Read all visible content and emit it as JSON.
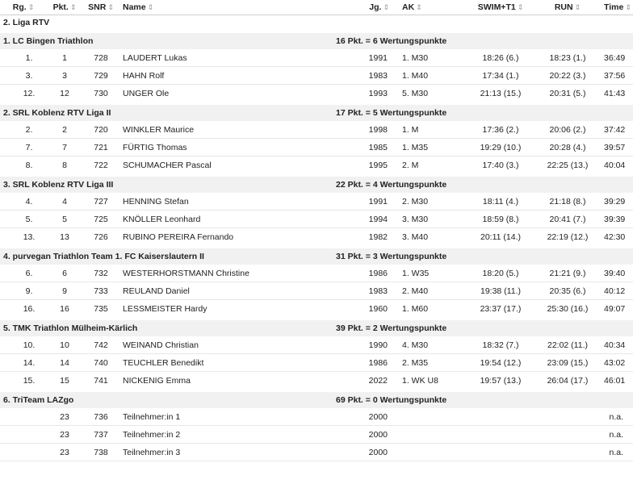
{
  "headers": {
    "rg": "Rg.",
    "pkt": "Pkt.",
    "snr": "SNR",
    "name": "Name",
    "jg": "Jg.",
    "ak": "AK",
    "swim": "SWIM+T1",
    "run": "RUN",
    "time": "Time",
    "sort_icon": "⇕"
  },
  "liga": "2. Liga RTV",
  "teams": [
    {
      "name": "1. LC Bingen Triathlon",
      "points": "16 Pkt. = 6 Wertungspunkte",
      "rows": [
        {
          "rg": "1.",
          "pkt": "1",
          "snr": "728",
          "name": "LAUDERT Lukas",
          "jg": "1991",
          "ak": "1. M30",
          "swim": "18:26 (6.)",
          "run": "18:23 (1.)",
          "time": "36:49"
        },
        {
          "rg": "3.",
          "pkt": "3",
          "snr": "729",
          "name": "HAHN Rolf",
          "jg": "1983",
          "ak": "1. M40",
          "swim": "17:34 (1.)",
          "run": "20:22 (3.)",
          "time": "37:56"
        },
        {
          "rg": "12.",
          "pkt": "12",
          "snr": "730",
          "name": "UNGER Ole",
          "jg": "1993",
          "ak": "5. M30",
          "swim": "21:13 (15.)",
          "run": "20:31 (5.)",
          "time": "41:43"
        }
      ]
    },
    {
      "name": "2. SRL Koblenz RTV Liga II",
      "points": "17 Pkt. = 5 Wertungspunkte",
      "rows": [
        {
          "rg": "2.",
          "pkt": "2",
          "snr": "720",
          "name": "WINKLER Maurice",
          "jg": "1998",
          "ak": "1. M",
          "swim": "17:36 (2.)",
          "run": "20:06 (2.)",
          "time": "37:42"
        },
        {
          "rg": "7.",
          "pkt": "7",
          "snr": "721",
          "name": "FÜRTIG Thomas",
          "jg": "1985",
          "ak": "1. M35",
          "swim": "19:29 (10.)",
          "run": "20:28 (4.)",
          "time": "39:57"
        },
        {
          "rg": "8.",
          "pkt": "8",
          "snr": "722",
          "name": "SCHUMACHER Pascal",
          "jg": "1995",
          "ak": "2. M",
          "swim": "17:40 (3.)",
          "run": "22:25 (13.)",
          "time": "40:04"
        }
      ]
    },
    {
      "name": "3. SRL Koblenz RTV Liga III",
      "points": "22 Pkt. = 4 Wertungspunkte",
      "rows": [
        {
          "rg": "4.",
          "pkt": "4",
          "snr": "727",
          "name": "HENNING Stefan",
          "jg": "1991",
          "ak": "2. M30",
          "swim": "18:11 (4.)",
          "run": "21:18 (8.)",
          "time": "39:29"
        },
        {
          "rg": "5.",
          "pkt": "5",
          "snr": "725",
          "name": "KNÖLLER Leonhard",
          "jg": "1994",
          "ak": "3. M30",
          "swim": "18:59 (8.)",
          "run": "20:41 (7.)",
          "time": "39:39"
        },
        {
          "rg": "13.",
          "pkt": "13",
          "snr": "726",
          "name": "RUBINO PEREIRA Fernando",
          "jg": "1982",
          "ak": "3. M40",
          "swim": "20:11 (14.)",
          "run": "22:19 (12.)",
          "time": "42:30"
        }
      ]
    },
    {
      "name": "4. purvegan Triathlon Team 1. FC Kaiserslautern II",
      "points": "31 Pkt. = 3 Wertungspunkte",
      "rows": [
        {
          "rg": "6.",
          "pkt": "6",
          "snr": "732",
          "name": "WESTERHORSTMANN Christine",
          "jg": "1986",
          "ak": "1. W35",
          "swim": "18:20 (5.)",
          "run": "21:21 (9.)",
          "time": "39:40"
        },
        {
          "rg": "9.",
          "pkt": "9",
          "snr": "733",
          "name": "REULAND Daniel",
          "jg": "1983",
          "ak": "2. M40",
          "swim": "19:38 (11.)",
          "run": "20:35 (6.)",
          "time": "40:12"
        },
        {
          "rg": "16.",
          "pkt": "16",
          "snr": "735",
          "name": "LESSMEISTER Hardy",
          "jg": "1960",
          "ak": "1. M60",
          "swim": "23:37 (17.)",
          "run": "25:30 (16.)",
          "time": "49:07"
        }
      ]
    },
    {
      "name": "5. TMK Triathlon Mülheim-Kärlich",
      "points": "39 Pkt. = 2 Wertungspunkte",
      "rows": [
        {
          "rg": "10.",
          "pkt": "10",
          "snr": "742",
          "name": "WEINAND Christian",
          "jg": "1990",
          "ak": "4. M30",
          "swim": "18:32 (7.)",
          "run": "22:02 (11.)",
          "time": "40:34"
        },
        {
          "rg": "14.",
          "pkt": "14",
          "snr": "740",
          "name": "TEUCHLER Benedikt",
          "jg": "1986",
          "ak": "2. M35",
          "swim": "19:54 (12.)",
          "run": "23:09 (15.)",
          "time": "43:02"
        },
        {
          "rg": "15.",
          "pkt": "15",
          "snr": "741",
          "name": "NICKENIG Emma",
          "jg": "2022",
          "ak": "1. WK U8",
          "swim": "19:57 (13.)",
          "run": "26:04 (17.)",
          "time": "46:01"
        }
      ]
    },
    {
      "name": "6. TriTeam LAZgo",
      "points": "69 Pkt. = 0 Wertungspunkte",
      "rows": [
        {
          "rg": "",
          "pkt": "23",
          "snr": "736",
          "name": "Teilnehmer:in 1",
          "jg": "2000",
          "ak": "",
          "swim": "",
          "run": "",
          "time": "n.a."
        },
        {
          "rg": "",
          "pkt": "23",
          "snr": "737",
          "name": "Teilnehmer:in 2",
          "jg": "2000",
          "ak": "",
          "swim": "",
          "run": "",
          "time": "n.a."
        },
        {
          "rg": "",
          "pkt": "23",
          "snr": "738",
          "name": "Teilnehmer:in 3",
          "jg": "2000",
          "ak": "",
          "swim": "",
          "run": "",
          "time": "n.a."
        }
      ]
    }
  ]
}
